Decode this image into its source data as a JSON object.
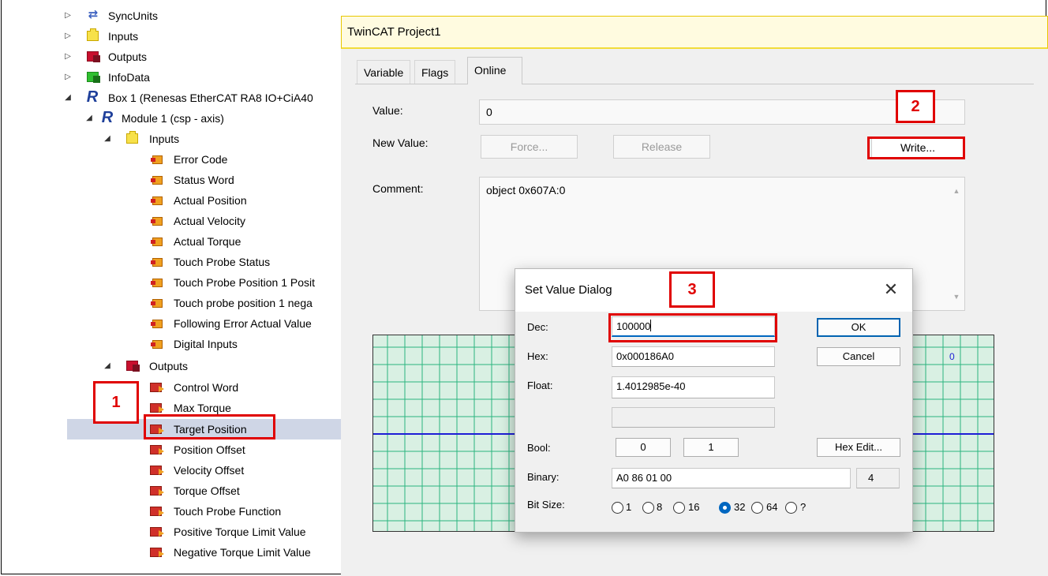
{
  "tree": {
    "items": [
      {
        "label": "SyncUnits"
      },
      {
        "label": "Inputs"
      },
      {
        "label": "Outputs"
      },
      {
        "label": "InfoData"
      },
      {
        "label": "Box 1 (Renesas EtherCAT RA8 IO+CiA40"
      },
      {
        "label": "Module 1 (csp - axis)"
      },
      {
        "label": "Inputs"
      },
      {
        "label": "Error Code"
      },
      {
        "label": "Status Word"
      },
      {
        "label": "Actual Position"
      },
      {
        "label": "Actual Velocity"
      },
      {
        "label": "Actual Torque"
      },
      {
        "label": "Touch Probe Status"
      },
      {
        "label": "Touch Probe Position 1 Posit"
      },
      {
        "label": "Touch probe position 1 nega"
      },
      {
        "label": "Following Error Actual Value"
      },
      {
        "label": "Digital Inputs"
      },
      {
        "label": "Outputs"
      },
      {
        "label": "Control Word"
      },
      {
        "label": "Max Torque"
      },
      {
        "label": "Target Position"
      },
      {
        "label": "Position Offset"
      },
      {
        "label": "Velocity Offset"
      },
      {
        "label": "Torque Offset"
      },
      {
        "label": "Touch Probe Function"
      },
      {
        "label": "Positive Torque Limit Value"
      },
      {
        "label": "Negative Torque Limit Value"
      }
    ]
  },
  "window": {
    "title": "TwinCAT Project1",
    "tabs": [
      {
        "label": "Variable"
      },
      {
        "label": "Flags"
      },
      {
        "label": "Online"
      }
    ],
    "value_label": "Value:",
    "value": "0",
    "new_value_label": "New Value:",
    "force_label": "Force...",
    "release_label": "Release",
    "write_label": "Write...",
    "comment_label": "Comment:",
    "comment": "object 0x607A:0",
    "chart_value": "0"
  },
  "dialog": {
    "title": "Set Value Dialog",
    "dec_label": "Dec:",
    "dec_value": "100000",
    "hex_label": "Hex:",
    "hex_value": "0x000186A0",
    "float_label": "Float:",
    "float_value": "1.4012985e-40",
    "bool_label": "Bool:",
    "bool_0": "0",
    "bool_1": "1",
    "hex_edit_label": "Hex Edit...",
    "binary_label": "Binary:",
    "binary_value": "A0 86 01 00",
    "binary_len": "4",
    "bitsize_label": "Bit Size:",
    "bitsizes": [
      "1",
      "8",
      "16",
      "32",
      "64",
      "?"
    ],
    "bitsize_selected": "32",
    "ok_label": "OK",
    "cancel_label": "Cancel"
  },
  "annotations": {
    "n1": "1",
    "n2": "2",
    "n3": "3"
  },
  "colors": {
    "annotation": "#e00000",
    "selection": "#cfd6e6",
    "chart_bg": "#d9f0e3",
    "chart_grid": "#2bb57f",
    "chart_line": "#1e1ed6",
    "title_bar": "#fffbe0"
  }
}
